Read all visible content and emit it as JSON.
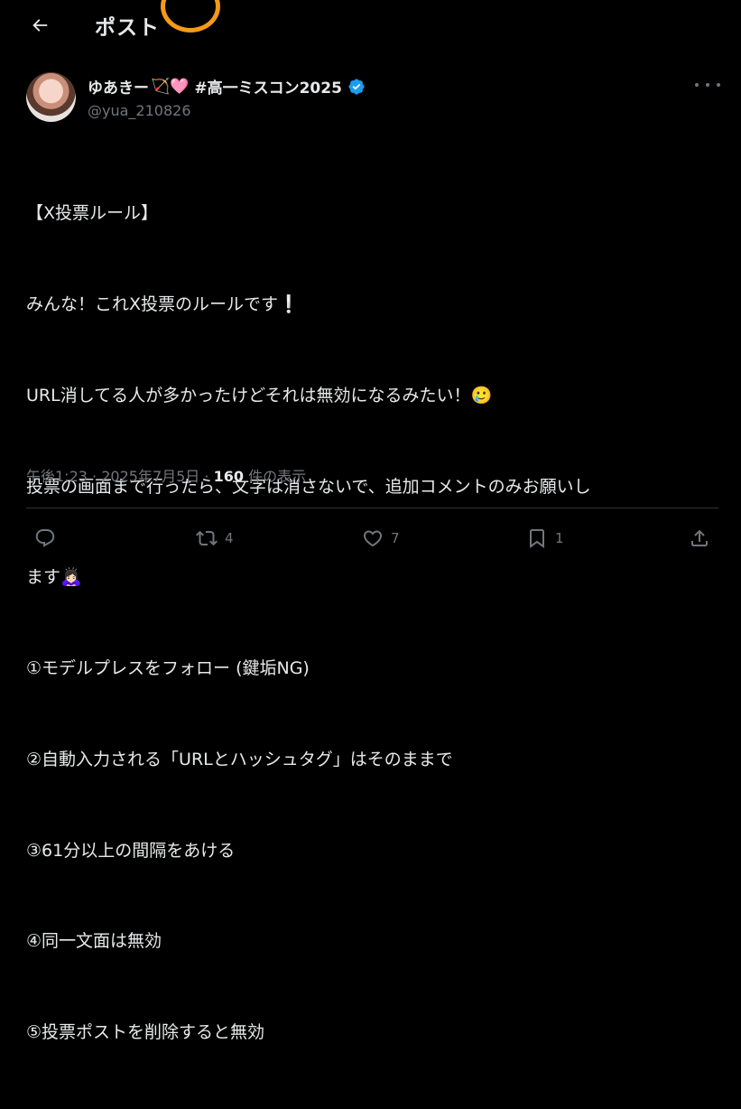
{
  "header": {
    "title": "ポスト"
  },
  "author": {
    "name": "ゆあきー",
    "emojis": "🏹🩷",
    "tag": "#高一ミスコン2025",
    "handle": "@yua_210826"
  },
  "post": {
    "lines": [
      "【X投票ルール】",
      "みんな！これX投票のルールです❕",
      "URL消してる人が多かったけどそれは無効になるみたい！🥲",
      "投票の画面まで行ったら、文字は消さないで、追加コメントのみお願いし",
      "ます🙇🏻‍♀️",
      "①モデルプレスをフォロー (鍵垢NG)",
      "②自動入力される「URLとハッシュタグ」はそのままで",
      "③61分以上の間隔をあける",
      "④同一文面は無効",
      "⑤投票ポストを削除すると無効"
    ]
  },
  "meta": {
    "time": "午後1:23",
    "separator": "·",
    "date": "2025年7月5日",
    "views_count": "160",
    "views_label": "件の表示"
  },
  "actions": {
    "reply_count": "",
    "repost_count": "4",
    "like_count": "7",
    "bookmark_count": "1"
  },
  "colors": {
    "background": "#000000",
    "text": "#e7e9ea",
    "secondary": "#71767b",
    "verified": "#1d9bf0",
    "highlight_ring": "#f59a15"
  }
}
